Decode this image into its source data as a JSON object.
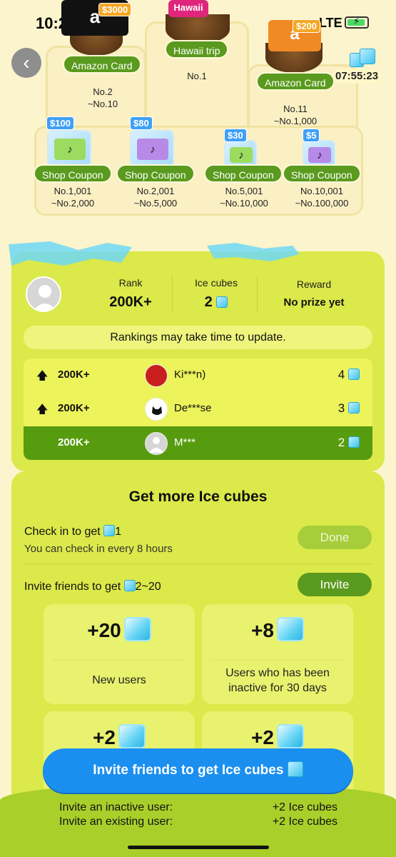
{
  "status_bar": {
    "time": "10:22",
    "network": "LTE"
  },
  "timer": "07:55:23",
  "prizes": {
    "top": [
      {
        "label": "Amazon Card",
        "range": "No.2\n~No.10",
        "value_tag": "$3000",
        "card_text": "a"
      },
      {
        "label": "Hawaii trip",
        "range": "No.1",
        "card_text": "Hawaii"
      },
      {
        "label": "Amazon Card",
        "range": "No.11\n~No.1,000",
        "value_tag": "$200",
        "card_text": "a"
      }
    ],
    "coupons": [
      {
        "label": "Shop Coupon",
        "value_tag": "$100",
        "range": "No.1,001\n~No.2,000"
      },
      {
        "label": "Shop Coupon",
        "value_tag": "$80",
        "range": "No.2,001\n~No.5,000"
      },
      {
        "label": "Shop Coupon",
        "value_tag": "$30",
        "range": "No.5,001\n~No.10,000"
      },
      {
        "label": "Shop Coupon",
        "value_tag": "$5",
        "range": "No.10,001\n~No.100,000"
      }
    ]
  },
  "stats": {
    "rank_label": "Rank",
    "rank_value": "200K+",
    "ice_label": "Ice cubes",
    "ice_value": "2",
    "reward_label": "Reward",
    "reward_value": "No prize yet"
  },
  "notice": "Rankings may take time to update.",
  "ranking": [
    {
      "rank": "200K+",
      "name": "Ki***n)",
      "score": "4"
    },
    {
      "rank": "200K+",
      "name": "De***se",
      "score": "3"
    },
    {
      "rank": "200K+",
      "name": "M***",
      "score": "2"
    }
  ],
  "more": {
    "title": "Get more Ice cubes",
    "checkin_title": "Check in to get",
    "checkin_amount": "1",
    "checkin_sub": "You can check in every 8 hours",
    "checkin_button": "Done",
    "invite_title": "Invite friends to get",
    "invite_amount": "2~20",
    "invite_button": "Invite",
    "tiles": [
      {
        "bonus": "+20",
        "desc": "New users"
      },
      {
        "bonus": "+8",
        "desc": "Users who has been inactive for 30 days"
      },
      {
        "bonus": "+2",
        "desc": ""
      },
      {
        "bonus": "+2",
        "desc": ""
      }
    ]
  },
  "cta": "Invite friends to get Ice cubes",
  "footer": [
    {
      "label": "Invite an inactive user:",
      "value": "+2 Ice cubes"
    },
    {
      "label": "Invite an existing user:",
      "value": "+2 Ice cubes"
    }
  ]
}
